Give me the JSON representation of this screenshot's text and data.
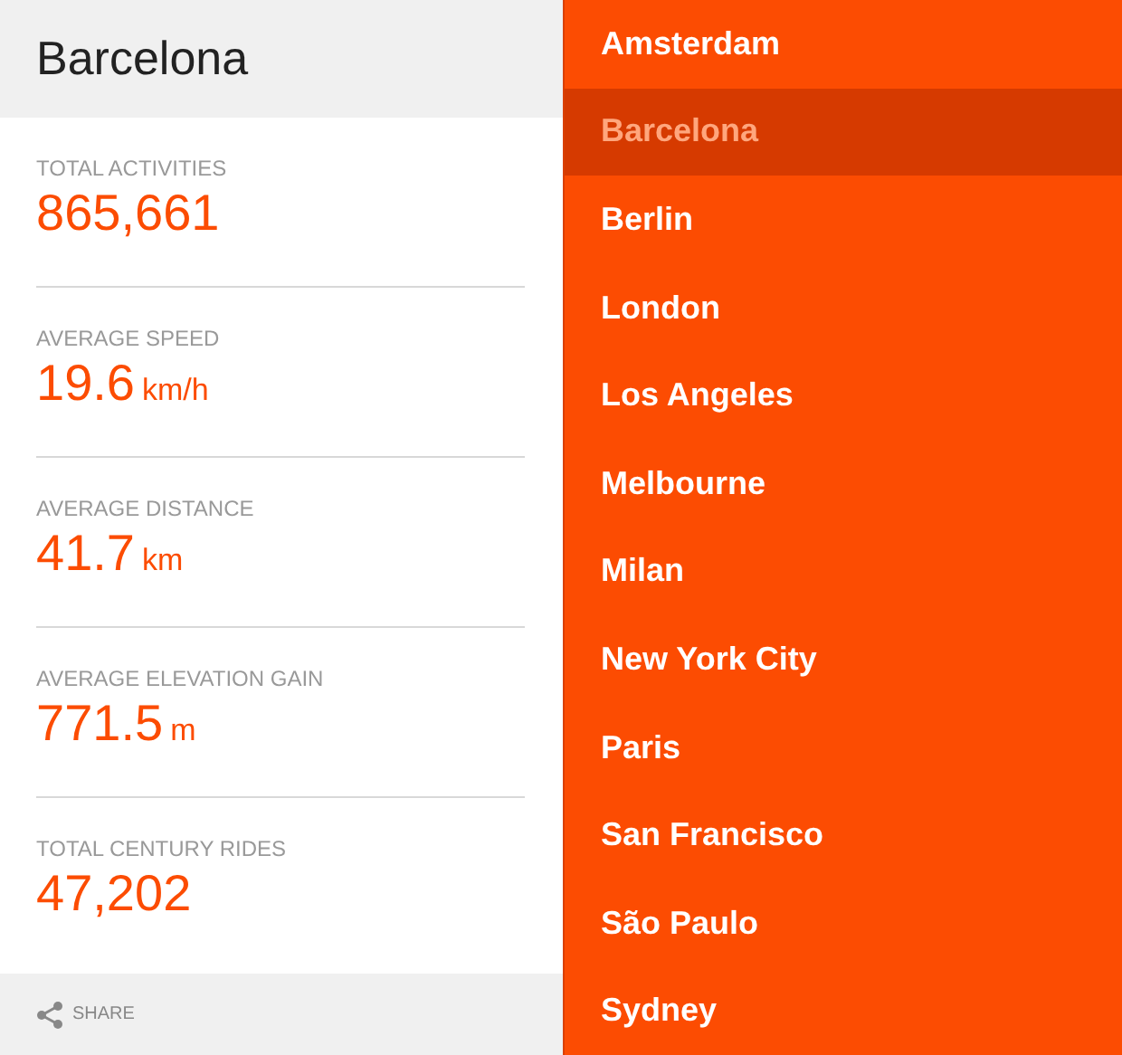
{
  "city_panel": {
    "title": "Barcelona",
    "stats": [
      {
        "label": "TOTAL ACTIVITIES",
        "value": "865,661"
      },
      {
        "label": "AVERAGE SPEED",
        "value": "19.6",
        "unit": "km/h"
      },
      {
        "label": "AVERAGE DISTANCE",
        "value": "41.7",
        "unit": "km"
      },
      {
        "label": "AVERAGE ELEVATION GAIN",
        "value": "771.5",
        "unit": "m"
      },
      {
        "label": "TOTAL CENTURY RIDES",
        "value": "47,202"
      }
    ],
    "share": "SHARE"
  },
  "city_list": [
    {
      "label": "Amsterdam",
      "selected": false
    },
    {
      "label": "Barcelona",
      "selected": true
    },
    {
      "label": "Berlin",
      "selected": false
    },
    {
      "label": "London",
      "selected": false
    },
    {
      "label": "Los Angeles",
      "selected": false
    },
    {
      "label": "Melbourne",
      "selected": false
    },
    {
      "label": "Milan",
      "selected": false
    },
    {
      "label": "New York City",
      "selected": false
    },
    {
      "label": "Paris",
      "selected": false
    },
    {
      "label": "San Francisco",
      "selected": false
    },
    {
      "label": "São Paulo",
      "selected": false
    },
    {
      "label": "Sydney",
      "selected": false
    }
  ]
}
